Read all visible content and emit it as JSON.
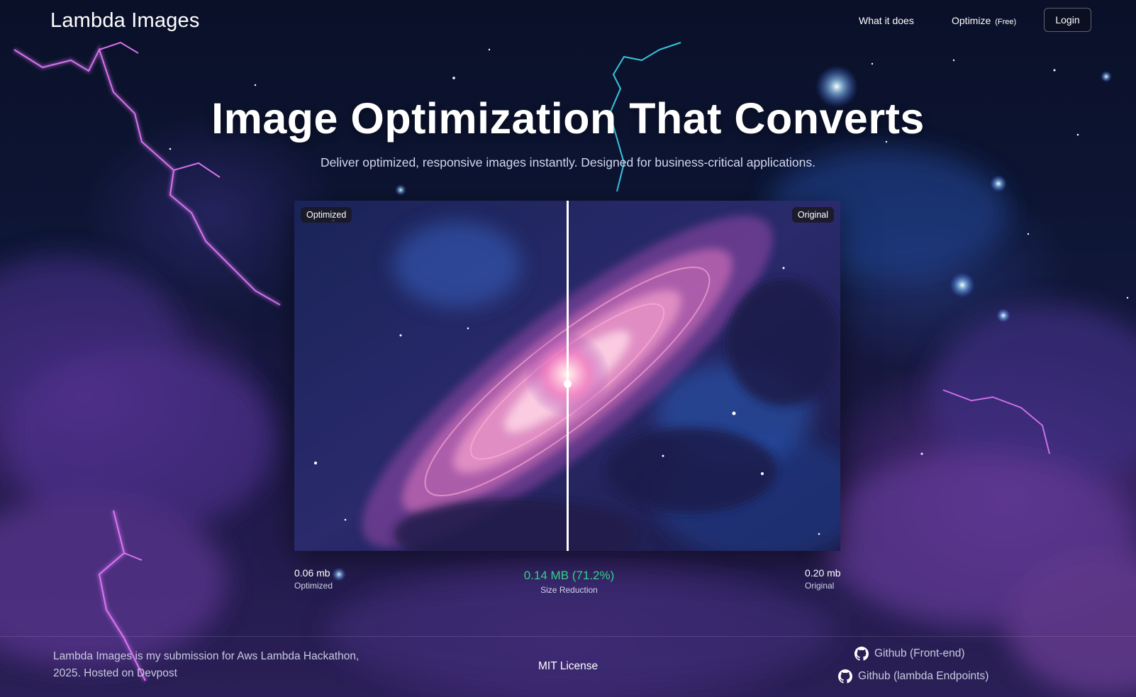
{
  "header": {
    "brand": "Lambda Images",
    "nav": {
      "what_it_does": "What it does",
      "optimize": "Optimize",
      "optimize_badge": "(Free)",
      "login": "Login"
    }
  },
  "hero": {
    "title": "Image Optimization That Converts",
    "subtitle": "Deliver optimized, responsive images instantly. Designed for business-critical applications."
  },
  "comparison": {
    "left_badge": "Optimized",
    "right_badge": "Original",
    "slider_position": 0.5
  },
  "stats": {
    "optimized_size": "0.06 mb",
    "optimized_label": "Optimized",
    "reduction_value": "0.14 MB (71.2%)",
    "reduction_label": "Size Reduction",
    "original_size": "0.20 mb",
    "original_label": "Original"
  },
  "footer": {
    "about": "Lambda Images is my submission for Aws Lambda Hackathon, 2025. Hosted on Devpost",
    "license": "MIT License",
    "links": [
      {
        "label": "Github (Front-end)",
        "icon": "github-icon"
      },
      {
        "label": "Github (lambda Endpoints)",
        "icon": "github-icon"
      }
    ]
  },
  "colors": {
    "accent_green": "#2fd38a",
    "background": "#0e1636",
    "galaxy_pink": "#ff8fd0"
  }
}
